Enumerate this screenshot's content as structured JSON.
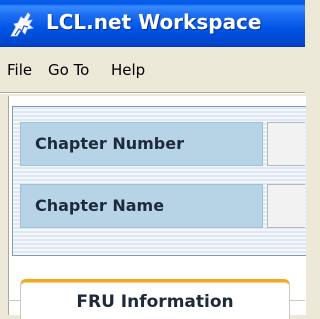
{
  "window": {
    "title": "LCL.net Workspace",
    "icon": "app-logo-icon"
  },
  "menu": {
    "items": [
      {
        "label": "File"
      },
      {
        "label": "Go To"
      },
      {
        "label": "Help"
      }
    ]
  },
  "form": {
    "fields": [
      {
        "label": "Chapter Number",
        "value": ""
      },
      {
        "label": "Chapter Name",
        "value": ""
      }
    ]
  },
  "tabs": [
    {
      "label": "FRU Information",
      "active": true
    }
  ],
  "colors": {
    "titlebar": "#0055e5",
    "label_bg": "#b7d4e6",
    "tab_accent": "#f5a623",
    "window_bg": "#ece9d8"
  }
}
